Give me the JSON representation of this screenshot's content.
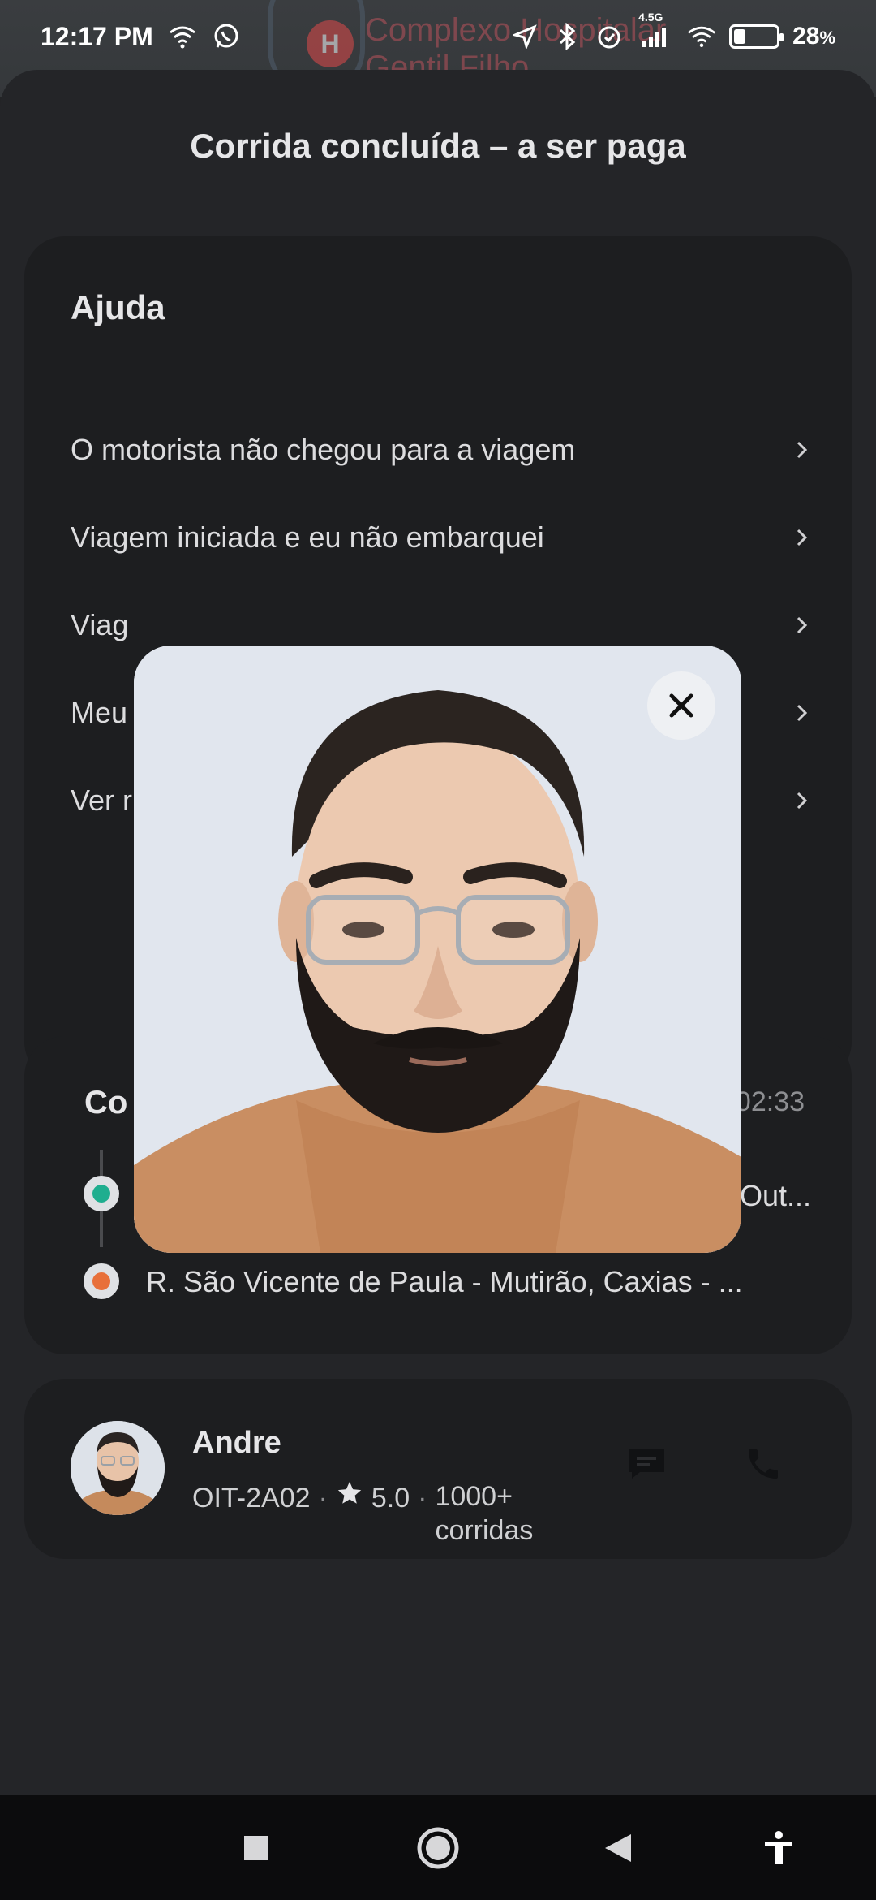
{
  "status_bar": {
    "time": "12:17 PM",
    "battery_percent": "28",
    "battery_percent_suffix": "%",
    "network_label": "4.5G",
    "icons": [
      "wifi-icon",
      "whatsapp-icon",
      "location-icon",
      "bluetooth-icon",
      "alarm-icon",
      "signal-icon",
      "wifi-icon",
      "battery-icon"
    ]
  },
  "map_background": {
    "place_label": "Complexo Hospitalar Gentil Filho",
    "pin_letter": "H"
  },
  "sheet": {
    "title": "Corrida concluída – a ser paga"
  },
  "help": {
    "title": "Ajuda",
    "items": [
      {
        "label": "O motorista não chegou para a viagem"
      },
      {
        "label": "Viagem iniciada e eu não embarquei"
      },
      {
        "label": "Viag"
      },
      {
        "label": "Meu"
      },
      {
        "label": "Ver r"
      }
    ]
  },
  "route": {
    "title": "Co",
    "time": "02:33",
    "pickup_address": "Out...",
    "dropoff_address": "R. São Vicente de Paula - Mutirão, Caxias - ...",
    "pickup_color": "#1fae8f",
    "dropoff_color": "#e8703a"
  },
  "driver": {
    "name": "Andre",
    "plate": "OIT-2A02",
    "separator": "·",
    "rating": "5.0",
    "trips": "1000+ corridas",
    "message_icon": "message-icon",
    "call_icon": "phone-icon"
  },
  "modal": {
    "image_description_icon": "driver-photo",
    "close_icon": "close-icon"
  },
  "nav_bar": {
    "icons": [
      "recents-square-icon",
      "home-circle-icon",
      "back-triangle-icon",
      "accessibility-icon"
    ]
  }
}
